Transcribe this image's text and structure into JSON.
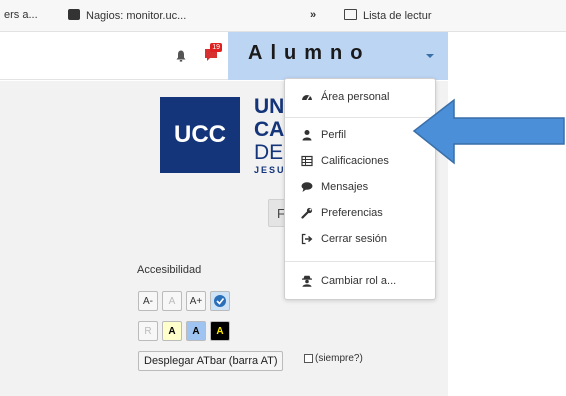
{
  "browser": {
    "bookmarks": [
      {
        "label": "ers a..."
      },
      {
        "label": "Nagios: monitor.uc..."
      },
      {
        "label": "»"
      },
      {
        "label": "Lista de lectur"
      }
    ]
  },
  "navbar": {
    "notification_count": "19",
    "user_name": "Alumno"
  },
  "branding": {
    "logo_text": "UCC",
    "name_lines": [
      "UN",
      "CA",
      "DE"
    ],
    "subtitle": "JESU"
  },
  "login_stub": {
    "label": "F"
  },
  "accessibility": {
    "title": "Accesibilidad",
    "font_buttons": [
      "A-",
      "A",
      "A+"
    ],
    "color_buttons": [
      "R",
      "A",
      "A",
      "A"
    ],
    "atbar_label": "Desplegar ATbar (barra AT)",
    "always_label": "(siempre?)"
  },
  "user_menu": {
    "items": [
      {
        "label": "Área personal",
        "icon": "dashboard-icon"
      },
      {
        "label": "Perfil",
        "icon": "user-icon"
      },
      {
        "label": "Calificaciones",
        "icon": "table-icon"
      },
      {
        "label": "Mensajes",
        "icon": "comment-icon"
      },
      {
        "label": "Preferencias",
        "icon": "wrench-icon"
      },
      {
        "label": "Cerrar sesión",
        "icon": "sign-out-icon"
      },
      {
        "label": "Cambiar rol a...",
        "icon": "user-secret-icon"
      }
    ]
  },
  "colors": {
    "brand_blue": "#14357a",
    "user_menu_bg": "#bcd5f3",
    "annotation_arrow": "#4a8fd8"
  }
}
